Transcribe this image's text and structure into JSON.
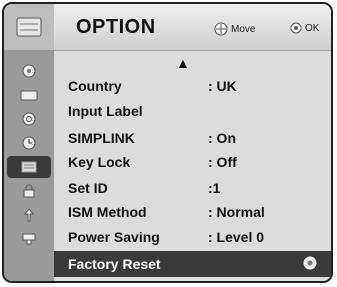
{
  "menu": {
    "title": "OPTION",
    "hints": {
      "move": "Move",
      "ok": "OK"
    },
    "items": [
      {
        "label": "Country",
        "value": ": UK"
      },
      {
        "label": "Input Label",
        "value": ""
      },
      {
        "label": "SIMPLINK",
        "value": ": On"
      },
      {
        "label": "Key Lock",
        "value": ": Off"
      },
      {
        "label": "Set ID",
        "value": ":1"
      },
      {
        "label": "ISM Method",
        "value": ": Normal"
      },
      {
        "label": "Power Saving",
        "value": ": Level 0"
      },
      {
        "label": "Factory Reset",
        "value": ""
      }
    ]
  },
  "sidebar_icons": [
    "picture-icon",
    "audio-icon",
    "tv-icon",
    "time-icon",
    "clock-icon",
    "option-icon",
    "lock-icon",
    "usb-icon",
    "support-icon"
  ]
}
